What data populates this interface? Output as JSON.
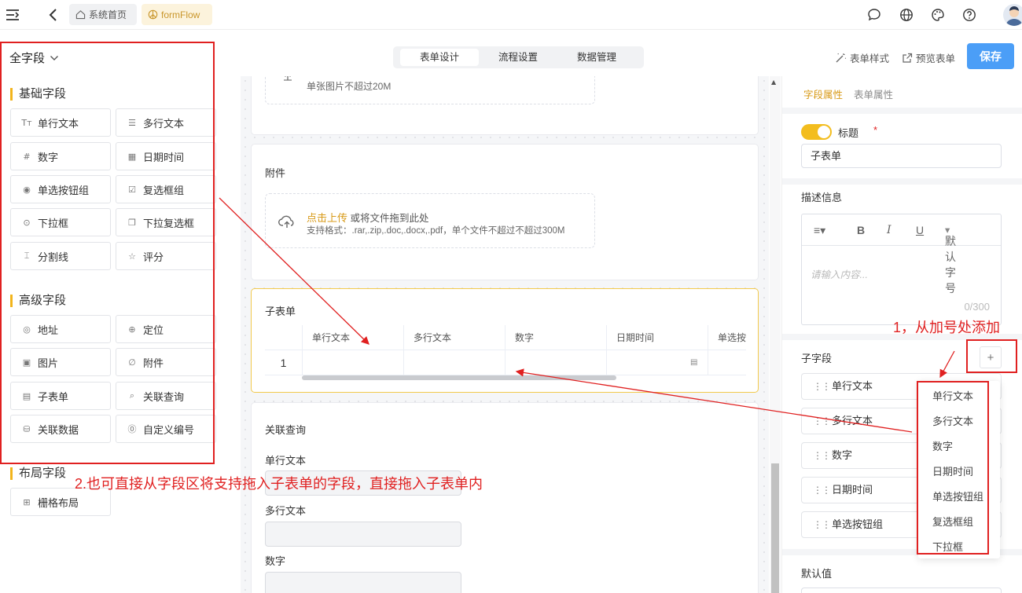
{
  "topbar": {
    "home_tag": "系统首页",
    "app_tag": "formFlow"
  },
  "header": {
    "tabs": [
      {
        "label": "表单设计",
        "active": true
      },
      {
        "label": "流程设置",
        "active": false
      },
      {
        "label": "数据管理",
        "active": false
      }
    ],
    "form_style_label": "表单样式",
    "preview_label": "预览表单",
    "save_label": "保存"
  },
  "left_panel": {
    "title": "全字段",
    "basic_group": {
      "title": "基础字段",
      "items": [
        {
          "label": "单行文本",
          "icon": "text-icon"
        },
        {
          "label": "多行文本",
          "icon": "multiline-icon"
        },
        {
          "label": "数字",
          "icon": "hash-icon"
        },
        {
          "label": "日期时间",
          "icon": "calendar-icon"
        },
        {
          "label": "单选按钮组",
          "icon": "radio-icon"
        },
        {
          "label": "复选框组",
          "icon": "checkbox-icon"
        },
        {
          "label": "下拉框",
          "icon": "select-icon"
        },
        {
          "label": "下拉复选框",
          "icon": "multi-select-icon"
        },
        {
          "label": "分割线",
          "icon": "divider-icon"
        },
        {
          "label": "评分",
          "icon": "star-icon"
        }
      ]
    },
    "advanced_group": {
      "title": "高级字段",
      "items": [
        {
          "label": "地址",
          "icon": "compass-icon"
        },
        {
          "label": "定位",
          "icon": "location-icon"
        },
        {
          "label": "图片",
          "icon": "image-icon"
        },
        {
          "label": "附件",
          "icon": "paperclip-icon"
        },
        {
          "label": "子表单",
          "icon": "table-icon"
        },
        {
          "label": "关联查询",
          "icon": "search-icon"
        },
        {
          "label": "关联数据",
          "icon": "database-icon"
        },
        {
          "label": "自定义编号",
          "icon": "number-icon"
        }
      ]
    },
    "layout_group": {
      "title": "布局字段",
      "items": [
        {
          "label": "栅格布局",
          "icon": "grid-icon"
        }
      ]
    }
  },
  "canvas": {
    "image_card": {
      "hint": "单张图片不超过20M"
    },
    "attachment_card": {
      "label": "附件",
      "upload_link": "点击上传",
      "upload_text": " 或将文件拖到此处",
      "formats": "支持格式：.rar,.zip,.doc,.docx,.pdf，单个文件不超过不超过300M"
    },
    "subform_card": {
      "label": "子表单",
      "columns": [
        "单行文本",
        "多行文本",
        "数字",
        "日期时间",
        "单选按"
      ],
      "row_numbers": [
        "1"
      ]
    },
    "lookup_card": {
      "label": "关联查询",
      "fields": [
        "单行文本",
        "多行文本",
        "数字"
      ]
    }
  },
  "right_panel": {
    "tabs": [
      {
        "label": "字段属性",
        "active": true
      },
      {
        "label": "表单属性",
        "active": false
      }
    ],
    "title_label": "标题",
    "required_mark": "*",
    "title_value": "子表单",
    "desc_label": "描述信息",
    "editor": {
      "font_size": "默认字号",
      "placeholder": "请输入内容...",
      "counter": "0/300"
    },
    "subfield_label": "子字段",
    "subfields": [
      "单行文本",
      "多行文本",
      "数字",
      "日期时间",
      "单选按钮组"
    ],
    "add_menu": [
      "单行文本",
      "多行文本",
      "数字",
      "日期时间",
      "单选按钮组",
      "复选框组",
      "下拉框"
    ],
    "default_label": "默认值"
  },
  "annotations": {
    "note_add": "1，从加号处添加",
    "note_drag": "2.也可直接从字段区将支持拖入子表单的字段，直接拖入子表单内"
  },
  "colors": {
    "accent": "#f3bd1e",
    "primary": "#4b9ef7",
    "annotation": "#e02020"
  }
}
